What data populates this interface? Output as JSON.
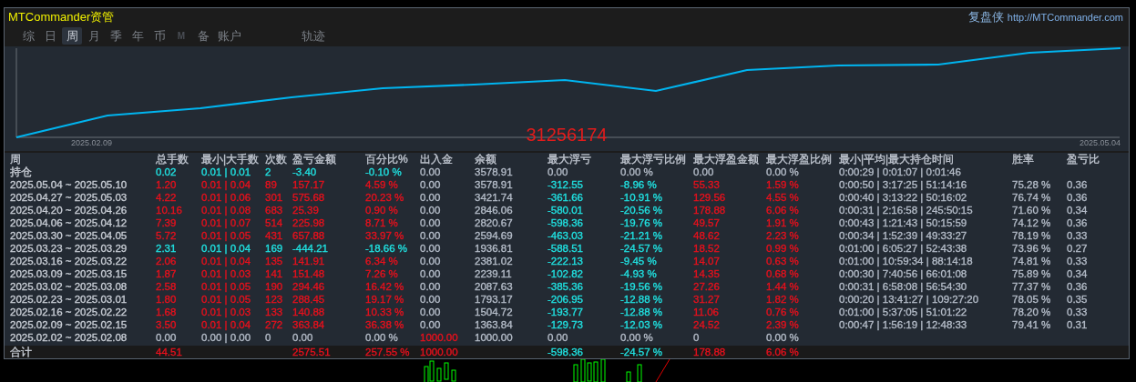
{
  "header": {
    "title": "MTCommander资管",
    "brand": "复盘侠",
    "url": "http://MTCommander.com"
  },
  "tabs": [
    {
      "label": "综",
      "selected": false,
      "disabled": false
    },
    {
      "label": "日",
      "selected": false,
      "disabled": false
    },
    {
      "label": "周",
      "selected": true,
      "disabled": false
    },
    {
      "label": "月",
      "selected": false,
      "disabled": false
    },
    {
      "label": "季",
      "selected": false,
      "disabled": false
    },
    {
      "label": "年",
      "selected": false,
      "disabled": false
    },
    {
      "label": "币",
      "selected": false,
      "disabled": false
    },
    {
      "label": "M",
      "selected": false,
      "disabled": true
    },
    {
      "label": "备",
      "selected": false,
      "disabled": false
    },
    {
      "label": "账户",
      "selected": false,
      "disabled": false
    }
  ],
  "extra_tabs": [
    {
      "label": "轨迹",
      "selected": false,
      "disabled": false
    }
  ],
  "chart": {
    "start_label": "2025.02.09",
    "end_label": "2025.05.04",
    "overlay_text": "31256174"
  },
  "table": {
    "columns": [
      "周",
      "总手数",
      "最小|大手数",
      "次数",
      "盈亏金额",
      "百分比%",
      "出入金",
      "余额",
      "最大浮亏",
      "最大浮亏比例",
      "最大浮盈金额",
      "最大浮盈比例",
      "最小|平均|最大持仓时间",
      "胜率",
      "盈亏比"
    ],
    "rows": [
      {
        "cells": [
          {
            "text": "持仓",
            "color": "#c8cdd5"
          },
          {
            "text": "0.02",
            "color": "#20e0e0"
          },
          {
            "text": "0.01 | 0.01",
            "color": "#20e0e0"
          },
          {
            "text": "2",
            "color": "#20e0e0"
          },
          {
            "text": "-3.40",
            "color": "#20e0e0"
          },
          {
            "text": "-0.10 %",
            "color": "#20e0e0"
          },
          {
            "text": "0.00",
            "color": "#b4bcc8"
          },
          {
            "text": "3578.91",
            "color": "#b4bcc8"
          },
          {
            "text": "0.00",
            "color": "#b4bcc8"
          },
          {
            "text": "0.00 %",
            "color": "#b4bcc8"
          },
          {
            "text": "0.00",
            "color": "#b4bcc8"
          },
          {
            "text": "0.00 %",
            "color": "#b4bcc8"
          },
          {
            "text": "0:00:29 | 0:01:07 | 0:01:46",
            "color": "#b4bcc8"
          }
        ]
      },
      {
        "cells": [
          {
            "text": "2025.05.04 ~ 2025.05.10",
            "color": "#c8cdd5"
          },
          {
            "text": "1.20",
            "color": "#e8101c"
          },
          {
            "text": "0.01 | 0.04",
            "color": "#e8101c"
          },
          {
            "text": "89",
            "color": "#e8101c"
          },
          {
            "text": "157.17",
            "color": "#e8101c"
          },
          {
            "text": "4.59 %",
            "color": "#e8101c"
          },
          {
            "text": "0.00",
            "color": "#b4bcc8"
          },
          {
            "text": "3578.91",
            "color": "#b4bcc8"
          },
          {
            "text": "-312.55",
            "color": "#20e0e0"
          },
          {
            "text": "-8.96 %",
            "color": "#20e0e0"
          },
          {
            "text": "55.33",
            "color": "#e8101c"
          },
          {
            "text": "1.59 %",
            "color": "#e8101c"
          },
          {
            "text": "0:00:50 | 3:17:25 | 51:14:16",
            "color": "#b4bcc8"
          },
          {
            "text": "75.28 %",
            "color": "#b4bcc8"
          },
          {
            "text": "0.36",
            "color": "#b4bcc8"
          }
        ]
      },
      {
        "cells": [
          {
            "text": "2025.04.27 ~ 2025.05.03",
            "color": "#c8cdd5"
          },
          {
            "text": "4.22",
            "color": "#e8101c"
          },
          {
            "text": "0.01 | 0.06",
            "color": "#e8101c"
          },
          {
            "text": "301",
            "color": "#e8101c"
          },
          {
            "text": "575.68",
            "color": "#e8101c"
          },
          {
            "text": "20.23 %",
            "color": "#e8101c"
          },
          {
            "text": "0.00",
            "color": "#b4bcc8"
          },
          {
            "text": "3421.74",
            "color": "#b4bcc8"
          },
          {
            "text": "-361.66",
            "color": "#20e0e0"
          },
          {
            "text": "-10.91 %",
            "color": "#20e0e0"
          },
          {
            "text": "129.56",
            "color": "#e8101c"
          },
          {
            "text": "4.55 %",
            "color": "#e8101c"
          },
          {
            "text": "0:00:40 | 3:13:22 | 50:16:02",
            "color": "#b4bcc8"
          },
          {
            "text": "76.74 %",
            "color": "#b4bcc8"
          },
          {
            "text": "0.36",
            "color": "#b4bcc8"
          }
        ]
      },
      {
        "cells": [
          {
            "text": "2025.04.20 ~ 2025.04.26",
            "color": "#c8cdd5"
          },
          {
            "text": "10.16",
            "color": "#e8101c"
          },
          {
            "text": "0.01 | 0.08",
            "color": "#e8101c"
          },
          {
            "text": "683",
            "color": "#e8101c"
          },
          {
            "text": "25.39",
            "color": "#e8101c"
          },
          {
            "text": "0.90 %",
            "color": "#e8101c"
          },
          {
            "text": "0.00",
            "color": "#b4bcc8"
          },
          {
            "text": "2846.06",
            "color": "#b4bcc8"
          },
          {
            "text": "-580.01",
            "color": "#20e0e0"
          },
          {
            "text": "-20.56 %",
            "color": "#20e0e0"
          },
          {
            "text": "178.88",
            "color": "#e8101c"
          },
          {
            "text": "6.06 %",
            "color": "#e8101c"
          },
          {
            "text": "0:00:31 | 2:16:58 | 245:50:15",
            "color": "#b4bcc8"
          },
          {
            "text": "71.60 %",
            "color": "#b4bcc8"
          },
          {
            "text": "0.34",
            "color": "#b4bcc8"
          }
        ]
      },
      {
        "cells": [
          {
            "text": "2025.04.06 ~ 2025.04.12",
            "color": "#c8cdd5"
          },
          {
            "text": "7.39",
            "color": "#e8101c"
          },
          {
            "text": "0.01 | 0.07",
            "color": "#e8101c"
          },
          {
            "text": "514",
            "color": "#e8101c"
          },
          {
            "text": "225.98",
            "color": "#e8101c"
          },
          {
            "text": "8.71 %",
            "color": "#e8101c"
          },
          {
            "text": "0.00",
            "color": "#b4bcc8"
          },
          {
            "text": "2820.67",
            "color": "#b4bcc8"
          },
          {
            "text": "-598.36",
            "color": "#20e0e0"
          },
          {
            "text": "-19.76 %",
            "color": "#20e0e0"
          },
          {
            "text": "49.57",
            "color": "#e8101c"
          },
          {
            "text": "1.91 %",
            "color": "#e8101c"
          },
          {
            "text": "0:00:43 | 1:21:43 | 50:15:59",
            "color": "#b4bcc8"
          },
          {
            "text": "74.12 %",
            "color": "#b4bcc8"
          },
          {
            "text": "0.36",
            "color": "#b4bcc8"
          }
        ]
      },
      {
        "cells": [
          {
            "text": "2025.03.30 ~ 2025.04.05",
            "color": "#c8cdd5"
          },
          {
            "text": "5.72",
            "color": "#e8101c"
          },
          {
            "text": "0.01 | 0.05",
            "color": "#e8101c"
          },
          {
            "text": "431",
            "color": "#e8101c"
          },
          {
            "text": "657.88",
            "color": "#e8101c"
          },
          {
            "text": "33.97 %",
            "color": "#e8101c"
          },
          {
            "text": "0.00",
            "color": "#b4bcc8"
          },
          {
            "text": "2594.69",
            "color": "#b4bcc8"
          },
          {
            "text": "-463.03",
            "color": "#20e0e0"
          },
          {
            "text": "-21.21 %",
            "color": "#20e0e0"
          },
          {
            "text": "48.62",
            "color": "#e8101c"
          },
          {
            "text": "2.23 %",
            "color": "#e8101c"
          },
          {
            "text": "0:00:34 | 1:52:39 | 49:33:27",
            "color": "#b4bcc8"
          },
          {
            "text": "78.19 %",
            "color": "#b4bcc8"
          },
          {
            "text": "0.33",
            "color": "#b4bcc8"
          }
        ]
      },
      {
        "cells": [
          {
            "text": "2025.03.23 ~ 2025.03.29",
            "color": "#c8cdd5"
          },
          {
            "text": "2.31",
            "color": "#20e0e0"
          },
          {
            "text": "0.01 | 0.04",
            "color": "#20e0e0"
          },
          {
            "text": "169",
            "color": "#20e0e0"
          },
          {
            "text": "-444.21",
            "color": "#20e0e0"
          },
          {
            "text": "-18.66 %",
            "color": "#20e0e0"
          },
          {
            "text": "0.00",
            "color": "#b4bcc8"
          },
          {
            "text": "1936.81",
            "color": "#b4bcc8"
          },
          {
            "text": "-588.51",
            "color": "#20e0e0"
          },
          {
            "text": "-24.57 %",
            "color": "#20e0e0"
          },
          {
            "text": "18.52",
            "color": "#e8101c"
          },
          {
            "text": "0.99 %",
            "color": "#e8101c"
          },
          {
            "text": "0:01:00 | 6:05:27 | 52:43:38",
            "color": "#b4bcc8"
          },
          {
            "text": "73.96 %",
            "color": "#b4bcc8"
          },
          {
            "text": "0.27",
            "color": "#b4bcc8"
          }
        ]
      },
      {
        "cells": [
          {
            "text": "2025.03.16 ~ 2025.03.22",
            "color": "#c8cdd5"
          },
          {
            "text": "2.06",
            "color": "#e8101c"
          },
          {
            "text": "0.01 | 0.04",
            "color": "#e8101c"
          },
          {
            "text": "135",
            "color": "#e8101c"
          },
          {
            "text": "141.91",
            "color": "#e8101c"
          },
          {
            "text": "6.34 %",
            "color": "#e8101c"
          },
          {
            "text": "0.00",
            "color": "#b4bcc8"
          },
          {
            "text": "2381.02",
            "color": "#b4bcc8"
          },
          {
            "text": "-222.13",
            "color": "#20e0e0"
          },
          {
            "text": "-9.45 %",
            "color": "#20e0e0"
          },
          {
            "text": "14.07",
            "color": "#e8101c"
          },
          {
            "text": "0.63 %",
            "color": "#e8101c"
          },
          {
            "text": "0:01:00 | 10:59:34 | 88:14:18",
            "color": "#b4bcc8"
          },
          {
            "text": "74.81 %",
            "color": "#b4bcc8"
          },
          {
            "text": "0.33",
            "color": "#b4bcc8"
          }
        ]
      },
      {
        "cells": [
          {
            "text": "2025.03.09 ~ 2025.03.15",
            "color": "#c8cdd5"
          },
          {
            "text": "1.87",
            "color": "#e8101c"
          },
          {
            "text": "0.01 | 0.03",
            "color": "#e8101c"
          },
          {
            "text": "141",
            "color": "#e8101c"
          },
          {
            "text": "151.48",
            "color": "#e8101c"
          },
          {
            "text": "7.26 %",
            "color": "#e8101c"
          },
          {
            "text": "0.00",
            "color": "#b4bcc8"
          },
          {
            "text": "2239.11",
            "color": "#b4bcc8"
          },
          {
            "text": "-102.82",
            "color": "#20e0e0"
          },
          {
            "text": "-4.93 %",
            "color": "#20e0e0"
          },
          {
            "text": "14.35",
            "color": "#e8101c"
          },
          {
            "text": "0.68 %",
            "color": "#e8101c"
          },
          {
            "text": "0:00:30 | 7:40:56 | 66:01:08",
            "color": "#b4bcc8"
          },
          {
            "text": "75.89 %",
            "color": "#b4bcc8"
          },
          {
            "text": "0.34",
            "color": "#b4bcc8"
          }
        ]
      },
      {
        "cells": [
          {
            "text": "2025.03.02 ~ 2025.03.08",
            "color": "#c8cdd5"
          },
          {
            "text": "2.58",
            "color": "#e8101c"
          },
          {
            "text": "0.01 | 0.05",
            "color": "#e8101c"
          },
          {
            "text": "190",
            "color": "#e8101c"
          },
          {
            "text": "294.46",
            "color": "#e8101c"
          },
          {
            "text": "16.42 %",
            "color": "#e8101c"
          },
          {
            "text": "0.00",
            "color": "#b4bcc8"
          },
          {
            "text": "2087.63",
            "color": "#b4bcc8"
          },
          {
            "text": "-385.36",
            "color": "#20e0e0"
          },
          {
            "text": "-19.56 %",
            "color": "#20e0e0"
          },
          {
            "text": "27.26",
            "color": "#e8101c"
          },
          {
            "text": "1.44 %",
            "color": "#e8101c"
          },
          {
            "text": "0:00:31 | 6:58:08 | 56:54:30",
            "color": "#b4bcc8"
          },
          {
            "text": "77.37 %",
            "color": "#b4bcc8"
          },
          {
            "text": "0.36",
            "color": "#b4bcc8"
          }
        ]
      },
      {
        "cells": [
          {
            "text": "2025.02.23 ~ 2025.03.01",
            "color": "#c8cdd5"
          },
          {
            "text": "1.80",
            "color": "#e8101c"
          },
          {
            "text": "0.01 | 0.05",
            "color": "#e8101c"
          },
          {
            "text": "123",
            "color": "#e8101c"
          },
          {
            "text": "288.45",
            "color": "#e8101c"
          },
          {
            "text": "19.17 %",
            "color": "#e8101c"
          },
          {
            "text": "0.00",
            "color": "#b4bcc8"
          },
          {
            "text": "1793.17",
            "color": "#b4bcc8"
          },
          {
            "text": "-206.95",
            "color": "#20e0e0"
          },
          {
            "text": "-12.88 %",
            "color": "#20e0e0"
          },
          {
            "text": "31.27",
            "color": "#e8101c"
          },
          {
            "text": "1.82 %",
            "color": "#e8101c"
          },
          {
            "text": "0:00:20 | 13:41:27 | 109:27:20",
            "color": "#b4bcc8"
          },
          {
            "text": "78.05 %",
            "color": "#b4bcc8"
          },
          {
            "text": "0.35",
            "color": "#b4bcc8"
          }
        ]
      },
      {
        "cells": [
          {
            "text": "2025.02.16 ~ 2025.02.22",
            "color": "#c8cdd5"
          },
          {
            "text": "1.68",
            "color": "#e8101c"
          },
          {
            "text": "0.01 | 0.03",
            "color": "#e8101c"
          },
          {
            "text": "133",
            "color": "#e8101c"
          },
          {
            "text": "140.88",
            "color": "#e8101c"
          },
          {
            "text": "10.33 %",
            "color": "#e8101c"
          },
          {
            "text": "0.00",
            "color": "#b4bcc8"
          },
          {
            "text": "1504.72",
            "color": "#b4bcc8"
          },
          {
            "text": "-193.77",
            "color": "#20e0e0"
          },
          {
            "text": "-12.88 %",
            "color": "#20e0e0"
          },
          {
            "text": "11.06",
            "color": "#e8101c"
          },
          {
            "text": "0.76 %",
            "color": "#e8101c"
          },
          {
            "text": "0:01:00 | 5:37:05 | 51:01:22",
            "color": "#b4bcc8"
          },
          {
            "text": "78.20 %",
            "color": "#b4bcc8"
          },
          {
            "text": "0.33",
            "color": "#b4bcc8"
          }
        ]
      },
      {
        "cells": [
          {
            "text": "2025.02.09 ~ 2025.02.15",
            "color": "#c8cdd5"
          },
          {
            "text": "3.50",
            "color": "#e8101c"
          },
          {
            "text": "0.01 | 0.04",
            "color": "#e8101c"
          },
          {
            "text": "272",
            "color": "#e8101c"
          },
          {
            "text": "363.84",
            "color": "#e8101c"
          },
          {
            "text": "36.38 %",
            "color": "#e8101c"
          },
          {
            "text": "0.00",
            "color": "#b4bcc8"
          },
          {
            "text": "1363.84",
            "color": "#b4bcc8"
          },
          {
            "text": "-129.73",
            "color": "#20e0e0"
          },
          {
            "text": "-12.03 %",
            "color": "#20e0e0"
          },
          {
            "text": "24.52",
            "color": "#e8101c"
          },
          {
            "text": "2.39 %",
            "color": "#e8101c"
          },
          {
            "text": "0:00:47 | 1:56:19 | 12:48:33",
            "color": "#b4bcc8"
          },
          {
            "text": "79.41 %",
            "color": "#b4bcc8"
          },
          {
            "text": "0.31",
            "color": "#b4bcc8"
          }
        ]
      },
      {
        "cells": [
          {
            "text": "2025.02.02 ~ 2025.02.08",
            "color": "#c8cdd5"
          },
          {
            "text": "0.00",
            "color": "#b4bcc8"
          },
          {
            "text": "0.00 | 0.00",
            "color": "#b4bcc8"
          },
          {
            "text": "0",
            "color": "#b4bcc8"
          },
          {
            "text": "0.00",
            "color": "#b4bcc8"
          },
          {
            "text": "0.00 %",
            "color": "#b4bcc8"
          },
          {
            "text": "1000.00",
            "color": "#e8101c"
          },
          {
            "text": "1000.00",
            "color": "#b4bcc8"
          },
          {
            "text": "0.00",
            "color": "#b4bcc8"
          },
          {
            "text": "0.00 %",
            "color": "#b4bcc8"
          },
          {
            "text": "0",
            "color": "#b4bcc8"
          },
          {
            "text": "0.00 %",
            "color": "#b4bcc8"
          }
        ]
      }
    ],
    "total": [
      {
        "text": "合计",
        "color": "#c8cdd5"
      },
      {
        "text": "44.51",
        "color": "#e8101c"
      },
      {
        "text": "2575.51",
        "color": "#e8101c"
      },
      {
        "text": "257.55 %",
        "color": "#e8101c"
      },
      {
        "text": "1000.00",
        "color": "#e8101c"
      },
      {
        "text": "-598.36",
        "color": "#20e0e0"
      },
      {
        "text": "-24.57 %",
        "color": "#20e0e0"
      },
      {
        "text": "178.88",
        "color": "#e8101c"
      },
      {
        "text": "6.06 %",
        "color": "#e8101c"
      }
    ]
  }
}
